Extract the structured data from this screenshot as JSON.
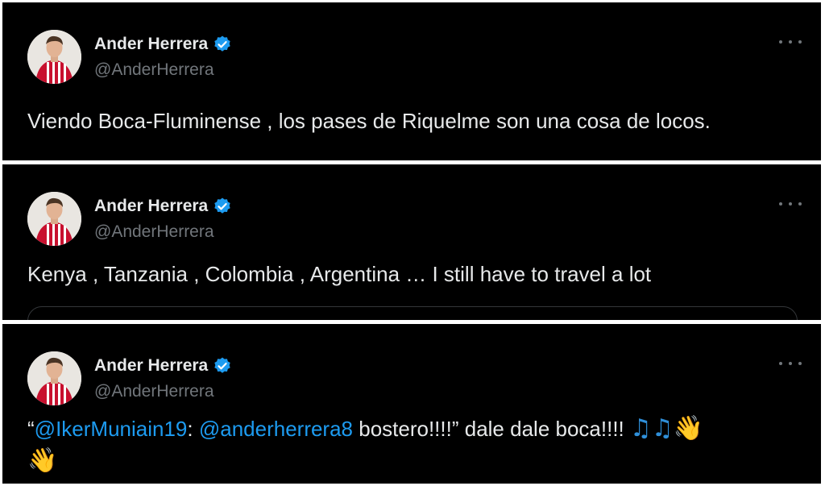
{
  "tweets": [
    {
      "author": {
        "name": "Ander Herrera",
        "handle": "@AnderHerrera"
      },
      "text": "Viendo Boca-Fluminense , los pases de Riquelme son una cosa de locos."
    },
    {
      "author": {
        "name": "Ander Herrera",
        "handle": "@AnderHerrera"
      },
      "text": "Kenya , Tanzania , Colombia , Argentina … I still have to travel a lot"
    },
    {
      "author": {
        "name": "Ander Herrera",
        "handle": "@AnderHerrera"
      },
      "text_parts": {
        "open_quote": "“",
        "mention_1": "@IkerMuniain19",
        "sep": ": ",
        "mention_2": "@anderherrera8",
        "rest": " bostero!!!!” dale dale boca!!!! ",
        "emoji_notes": "♫♫",
        "emoji_wave_1": "👋",
        "emoji_wave_2": "👋"
      }
    }
  ],
  "icons": {
    "verified": "verified-badge-icon",
    "more": "more-options-icon",
    "music_notes": "music-notes-emoji",
    "waving_hand": "waving-hand-emoji"
  },
  "colors": {
    "background": "#000000",
    "text": "#e7e9ea",
    "secondary_text": "#71767b",
    "accent": "#1d9bf0"
  }
}
